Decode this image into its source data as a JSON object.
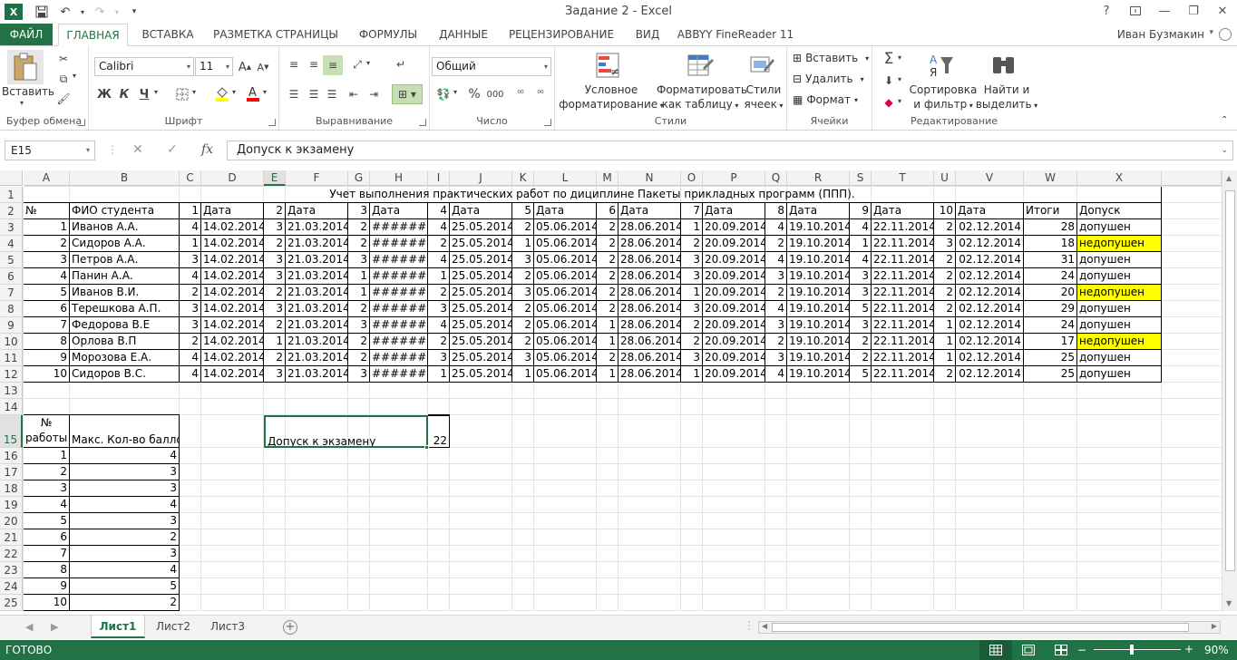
{
  "window": {
    "title": "Задание 2 - Excel",
    "app_icon": "X",
    "help": "?",
    "user": "Иван Бузмакин"
  },
  "tabs": [
    "ФАЙЛ",
    "ГЛАВНАЯ",
    "ВСТАВКА",
    "РАЗМЕТКА СТРАНИЦЫ",
    "ФОРМУЛЫ",
    "ДАННЫЕ",
    "РЕЦЕНЗИРОВАНИЕ",
    "ВИД",
    "ABBYY FineReader 11"
  ],
  "ribbon": {
    "clipboard": {
      "paste": "Вставить",
      "label": "Буфер обмена"
    },
    "font": {
      "name": "Calibri",
      "size": "11",
      "bold": "Ж",
      "italic": "К",
      "underline": "Ч",
      "label": "Шрифт"
    },
    "alignment": {
      "label": "Выравнивание"
    },
    "number": {
      "format": "Общий",
      "percent": "%",
      "thousands": "000",
      "label": "Число"
    },
    "styles": {
      "conditional_1": "Условное",
      "conditional_2": "форматирование",
      "table_1": "Форматировать",
      "table_2": "как таблицу",
      "cell_1": "Стили",
      "cell_2": "ячеек",
      "label": "Стили"
    },
    "cells": {
      "insert": "Вставить",
      "delete": "Удалить",
      "format": "Формат",
      "label": "Ячейки"
    },
    "editing": {
      "sort_1": "Сортировка",
      "sort_2": "и фильтр",
      "find_1": "Найти и",
      "find_2": "выделить",
      "label": "Редактирование"
    }
  },
  "formula_bar": {
    "name_box": "E15",
    "fx": "fx",
    "value": "Допуск к экзамену"
  },
  "columns": [
    "A",
    "B",
    "C",
    "D",
    "E",
    "F",
    "G",
    "H",
    "I",
    "J",
    "K",
    "L",
    "M",
    "N",
    "O",
    "P",
    "Q",
    "R",
    "S",
    "T",
    "U",
    "V",
    "W",
    "X"
  ],
  "rows": [
    "1",
    "2",
    "3",
    "4",
    "5",
    "6",
    "7",
    "8",
    "9",
    "10",
    "11",
    "12",
    "13",
    "14",
    "15",
    "16",
    "17",
    "18",
    "19",
    "20",
    "21",
    "22",
    "23",
    "24",
    "25"
  ],
  "sheet": {
    "title": "Учет выполнения практических работ по дициплине Пакеты прикладных программ (ППП).",
    "header": [
      "№",
      "ФИО студента",
      "1",
      "Дата",
      "2",
      "Дата",
      "3",
      "Дата",
      "4",
      "Дата",
      "5",
      "Дата",
      "6",
      "Дата",
      "7",
      "Дата",
      "8",
      "Дата",
      "9",
      "Дата",
      "10",
      "Дата",
      "Итоги",
      "Допуск"
    ],
    "students": [
      [
        "1",
        "Иванов А.А.",
        "4",
        "14.02.2014",
        "3",
        "21.03.2014",
        "2",
        "##########",
        "4",
        "25.05.2014",
        "2",
        "05.06.2014",
        "2",
        "28.06.2014",
        "1",
        "20.09.2014",
        "4",
        "19.10.2014",
        "4",
        "22.11.2014",
        "2",
        "02.12.2014",
        "28",
        "допушен"
      ],
      [
        "2",
        "Сидоров А.А.",
        "1",
        "14.02.2014",
        "2",
        "21.03.2014",
        "2",
        "##########",
        "2",
        "25.05.2014",
        "1",
        "05.06.2014",
        "2",
        "28.06.2014",
        "2",
        "20.09.2014",
        "2",
        "19.10.2014",
        "1",
        "22.11.2014",
        "3",
        "02.12.2014",
        "18",
        "недопушен"
      ],
      [
        "3",
        "Петров А.А.",
        "3",
        "14.02.2014",
        "3",
        "21.03.2014",
        "3",
        "##########",
        "4",
        "25.05.2014",
        "3",
        "05.06.2014",
        "2",
        "28.06.2014",
        "3",
        "20.09.2014",
        "4",
        "19.10.2014",
        "4",
        "22.11.2014",
        "2",
        "02.12.2014",
        "31",
        "допушен"
      ],
      [
        "4",
        "Панин А.А.",
        "4",
        "14.02.2014",
        "3",
        "21.03.2014",
        "1",
        "##########",
        "1",
        "25.05.2014",
        "2",
        "05.06.2014",
        "2",
        "28.06.2014",
        "3",
        "20.09.2014",
        "3",
        "19.10.2014",
        "3",
        "22.11.2014",
        "2",
        "02.12.2014",
        "24",
        "допушен"
      ],
      [
        "5",
        "Иванов В.И.",
        "2",
        "14.02.2014",
        "2",
        "21.03.2014",
        "1",
        "##########",
        "2",
        "25.05.2014",
        "3",
        "05.06.2014",
        "2",
        "28.06.2014",
        "1",
        "20.09.2014",
        "2",
        "19.10.2014",
        "3",
        "22.11.2014",
        "2",
        "02.12.2014",
        "20",
        "недопушен"
      ],
      [
        "6",
        "Терешкова А.П.",
        "3",
        "14.02.2014",
        "3",
        "21.03.2014",
        "2",
        "##########",
        "3",
        "25.05.2014",
        "2",
        "05.06.2014",
        "2",
        "28.06.2014",
        "3",
        "20.09.2014",
        "4",
        "19.10.2014",
        "5",
        "22.11.2014",
        "2",
        "02.12.2014",
        "29",
        "допушен"
      ],
      [
        "7",
        "Федорова В.Е",
        "3",
        "14.02.2014",
        "2",
        "21.03.2014",
        "3",
        "##########",
        "4",
        "25.05.2014",
        "2",
        "05.06.2014",
        "1",
        "28.06.2014",
        "2",
        "20.09.2014",
        "3",
        "19.10.2014",
        "3",
        "22.11.2014",
        "1",
        "02.12.2014",
        "24",
        "допушен"
      ],
      [
        "8",
        "Орлова В.П",
        "2",
        "14.02.2014",
        "1",
        "21.03.2014",
        "2",
        "##########",
        "2",
        "25.05.2014",
        "2",
        "05.06.2014",
        "1",
        "28.06.2014",
        "2",
        "20.09.2014",
        "2",
        "19.10.2014",
        "2",
        "22.11.2014",
        "1",
        "02.12.2014",
        "17",
        "недопушен"
      ],
      [
        "9",
        "Морозова Е.А.",
        "4",
        "14.02.2014",
        "2",
        "21.03.2014",
        "2",
        "##########",
        "3",
        "25.05.2014",
        "3",
        "05.06.2014",
        "2",
        "28.06.2014",
        "3",
        "20.09.2014",
        "3",
        "19.10.2014",
        "2",
        "22.11.2014",
        "1",
        "02.12.2014",
        "25",
        "допушен"
      ],
      [
        "10",
        "Сидоров В.С.",
        "4",
        "14.02.2014",
        "3",
        "21.03.2014",
        "3",
        "##########",
        "1",
        "25.05.2014",
        "1",
        "05.06.2014",
        "1",
        "28.06.2014",
        "1",
        "20.09.2014",
        "4",
        "19.10.2014",
        "5",
        "22.11.2014",
        "2",
        "02.12.2014",
        "25",
        "допушен"
      ]
    ],
    "highlight_color": "#ffff00",
    "max_table": {
      "header_1a": "№",
      "header_1b": "работы",
      "header_2": "Макс. Кол-во баллов",
      "rows": [
        [
          "1",
          "4"
        ],
        [
          "2",
          "3"
        ],
        [
          "3",
          "3"
        ],
        [
          "4",
          "4"
        ],
        [
          "5",
          "3"
        ],
        [
          "6",
          "2"
        ],
        [
          "7",
          "3"
        ],
        [
          "8",
          "4"
        ],
        [
          "9",
          "5"
        ],
        [
          "10",
          "2"
        ]
      ]
    },
    "admission_label": "Допуск к экзамену",
    "admission_value": "22"
  },
  "sheet_tabs": [
    "Лист1",
    "Лист2",
    "Лист3"
  ],
  "status": {
    "text": "ГОТОВО",
    "zoom": "90%"
  },
  "colors": {
    "accent": "#217346"
  }
}
